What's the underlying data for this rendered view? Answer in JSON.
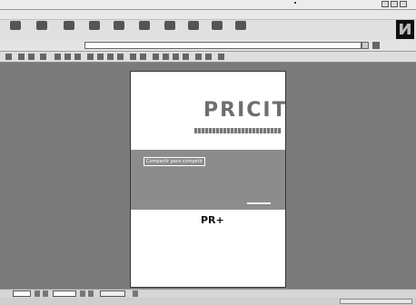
{
  "titlebar": {
    "title": ""
  },
  "menu": [
    "",
    "",
    "",
    "",
    "",
    ""
  ],
  "toolbar": {
    "buttons": [
      {
        "label": "",
        "icon": "back-arrow-icon"
      },
      {
        "label": "",
        "icon": "forward-arrow-icon"
      },
      {
        "label": "",
        "icon": "stop-icon"
      },
      {
        "label": "",
        "icon": "refresh-icon"
      },
      {
        "label": "",
        "icon": "home-icon"
      },
      {
        "label": "",
        "icon": "search-icon"
      },
      {
        "label": "",
        "icon": "favorites-icon"
      },
      {
        "label": "",
        "icon": "history-icon"
      },
      {
        "label": "",
        "icon": "mail-icon"
      },
      {
        "label": "",
        "icon": "print-icon"
      }
    ]
  },
  "address": {
    "links_label": "",
    "label": "",
    "url": "",
    "go_label": ""
  },
  "document": {
    "title": "PRICIT",
    "tagline": "Compartir para competir",
    "logo": "PR+"
  },
  "navbar": {
    "zoom": "",
    "page": "",
    "size": ""
  },
  "status": {
    "text": "",
    "zone": ""
  }
}
